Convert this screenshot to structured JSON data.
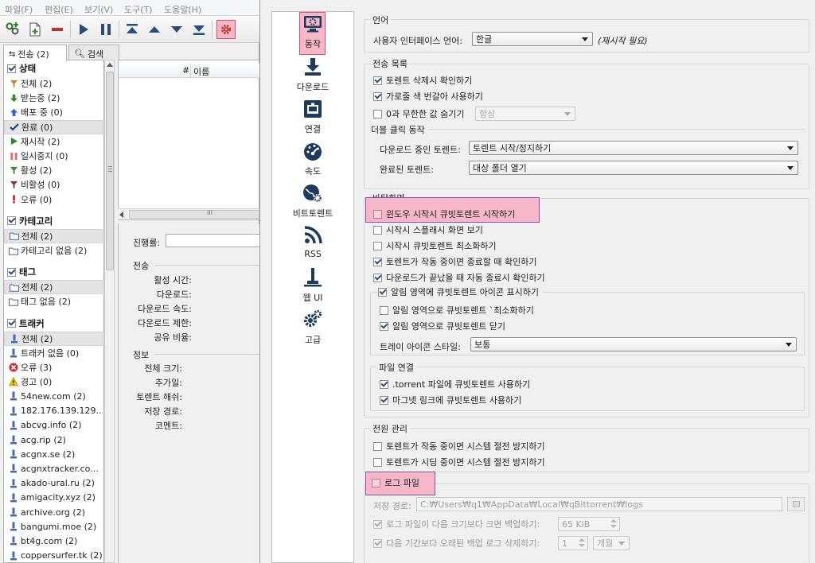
{
  "main": {
    "menu": [
      "파일(F)",
      "편집(E)",
      "보기(V)",
      "도구(T)",
      "도움말(H)"
    ],
    "tabs": [
      {
        "label": "전송 (2)"
      },
      {
        "label": "검색"
      }
    ],
    "status": {
      "title": "상태",
      "items": [
        {
          "label": "전체 (2)",
          "icon": "filter-icon"
        },
        {
          "label": "받는중 (2)",
          "icon": "arrow-down-icon"
        },
        {
          "label": "배포 중 (0)",
          "icon": "arrow-up-icon"
        },
        {
          "label": "완료 (0)",
          "icon": "checkmark-icon",
          "selected": true
        },
        {
          "label": "재시작 (2)",
          "icon": "play-icon"
        },
        {
          "label": "일시중지 (0)",
          "icon": "pause-icon"
        },
        {
          "label": "활성 (2)",
          "icon": "filter-icon"
        },
        {
          "label": "비활성 (0)",
          "icon": "filter-icon"
        },
        {
          "label": "오류 (0)",
          "icon": "exclamation-icon"
        }
      ]
    },
    "category": {
      "title": "카테고리",
      "items": [
        {
          "label": "전체 (2)",
          "icon": "folder-icon",
          "selected": true
        },
        {
          "label": "카테고리 없음 (2)",
          "icon": "folder-icon"
        }
      ]
    },
    "tag": {
      "title": "태그",
      "items": [
        {
          "label": "전체 (2)",
          "icon": "folder-icon",
          "selected": true
        },
        {
          "label": "태그 없음 (2)",
          "icon": "folder-icon"
        }
      ]
    },
    "tracker": {
      "title": "트래커",
      "items": [
        {
          "label": "전체 (2)",
          "icon": "tracker-icon",
          "selected": true
        },
        {
          "label": "트래커 없음 (0)",
          "icon": "tracker-icon"
        },
        {
          "label": "오류 (3)",
          "icon": "error-icon"
        },
        {
          "label": "경고 (0)",
          "icon": "warning-icon"
        },
        {
          "label": "54new.com (2)",
          "icon": "tracker-icon"
        },
        {
          "label": "182.176.139.129...",
          "icon": "tracker-icon"
        },
        {
          "label": "abcvg.info (2)",
          "icon": "tracker-icon"
        },
        {
          "label": "acg.rip (2)",
          "icon": "tracker-icon"
        },
        {
          "label": "acgnx.se (2)",
          "icon": "tracker-icon"
        },
        {
          "label": "acgnxtracker.co...",
          "icon": "tracker-icon"
        },
        {
          "label": "akado-ural.ru (2)",
          "icon": "tracker-icon"
        },
        {
          "label": "amigacity.xyz (2)",
          "icon": "tracker-icon"
        },
        {
          "label": "archive.org (2)",
          "icon": "tracker-icon"
        },
        {
          "label": "bangumi.moe (2)",
          "icon": "tracker-icon"
        },
        {
          "label": "bt4g.com (2)",
          "icon": "tracker-icon"
        },
        {
          "label": "coppersurfer.tk (2)",
          "icon": "tracker-icon"
        }
      ]
    },
    "list": {
      "col_num": "#",
      "col_name": "이름",
      "hscroll_grip": "III"
    },
    "details": {
      "progress_label": "진행률:",
      "transfer_title": "전송",
      "transfer_fields": [
        "활성 시간:",
        "다운로드:",
        "다운로드 속도:",
        "다운로드 제한:",
        "공유 비율:"
      ],
      "info_title": "정보",
      "info_fields": [
        "전체 크기:",
        "추가일:",
        "토렌트 해쉬:",
        "저장 경로:",
        "코멘트:"
      ]
    }
  },
  "dialog": {
    "nav": [
      {
        "label": "동작",
        "icon": "monitor-gear-icon",
        "selected": true
      },
      {
        "label": "다운로드",
        "icon": "download-icon"
      },
      {
        "label": "연결",
        "icon": "network-port-icon"
      },
      {
        "label": "속도",
        "icon": "speedometer-icon"
      },
      {
        "label": "비트토렌트",
        "icon": "globe-gear-icon"
      },
      {
        "label": "RSS",
        "icon": "rss-icon"
      },
      {
        "label": "웹 UI",
        "icon": "webui-icon"
      },
      {
        "label": "고급",
        "icon": "gears-icon"
      }
    ],
    "language": {
      "title": "언어",
      "ui_lang_label": "사용자 인터페이스 언어:",
      "ui_lang_value": "한글",
      "restart_note": "(재시작 필요)"
    },
    "transfer_list": {
      "title": "전송 목록",
      "confirm_delete": "토렌트 삭제시 확인하기",
      "alt_row_colors": "가로줄 색 번갈아 사용하기",
      "hide_zero": "0과 무한한 값 숨기기",
      "hide_zero_option": "항상",
      "double_click_title": "더블 클릭 동작",
      "downloading_label": "다운로드 중인 토렌트:",
      "downloading_value": "토렌트 시작/정지하기",
      "completed_label": "완료된 토렌트:",
      "completed_value": "대상 폴더 열기"
    },
    "desktop": {
      "title": "바탕화면",
      "start_on_boot": "윈도우 시작시 큐빗토렌트 시작하기",
      "splash": "시작시 스플래시 화면 보기",
      "start_minimized": "시작시 큐빗토렌트 최소화하기",
      "confirm_exit_active": "토렌트가 작동 중이면 종료할 때 확인하기",
      "confirm_auto_exit": "다운로드가 끝났을 때 자동 종료시 확인하기",
      "tray_title": "알림 영역에 큐빗토렌트 아이콘 표시하기",
      "minimize_tray": "알림 영역으로 큐빗토렌트 `최소화하기",
      "close_tray": "알림 영역으로 큐빗토렌트 닫기",
      "tray_style_label": "트레이 아이콘 스타일:",
      "tray_style_value": "보통",
      "file_assoc_title": "파일 연결",
      "torrent_assoc": ".torrent 파일에 큐빗토렌트 사용하기",
      "magnet_assoc": "마그넷 링크에 큐빗토렌트 사용하기"
    },
    "power": {
      "title": "전원 관리",
      "inhibit_active": "토렌트가 작동 중이면 시스템 절전 방지하기",
      "inhibit_seeding": "토렌트가 시딩 중이면 시스템 절전 방지하기"
    },
    "log": {
      "title": "로그 파일",
      "save_path_label": "저장 경로:",
      "save_path_value": "C:₩Users₩q1₩AppData₩Local₩qBittorrent₩logs",
      "backup_label": "로그 파일이 다음 크기보다 크면 백업하기:",
      "backup_size": "65 KiB",
      "delete_label": "다음 기간보다 오래된 백업 로그 삭제하기:",
      "delete_count": "1",
      "delete_unit": "개월"
    }
  },
  "colors": {
    "highlight_fill": "#f6b8c8",
    "highlight_border": "#d44f6c",
    "accent": "#2b4a8a"
  }
}
